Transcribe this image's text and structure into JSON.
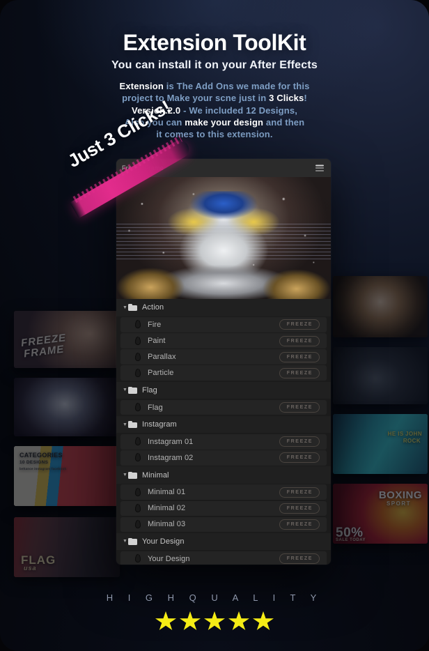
{
  "header": {
    "title": "Extension ToolKit",
    "subtitle": "You can install it on your After Effects"
  },
  "blurb": {
    "l1_bold": "Extension",
    "l1_rest": " is The Add Ons we made for this",
    "l2_a": "project to Make your scne just in ",
    "l2_bold": "3 Clicks",
    "l2_b": "!",
    "l3_bold": "Version.2.0",
    "l3_rest": " - We included 12 Designs,",
    "l4_a": "Also you can ",
    "l4_bold": "make your design",
    "l4_b": " and then",
    "l5": "it comes to this extension."
  },
  "badge": {
    "label": "Just 3 Clicks!"
  },
  "panel": {
    "header_title": "Freeze Frame",
    "menu_icon": "hamburger-menu-icon",
    "hero_image_alt": "ATV quad bike rider freeze frame preview",
    "freeze_label": "FREEZE",
    "rows": [
      {
        "type": "group",
        "label": "Action",
        "icon": "folder-icon",
        "caret": "▼"
      },
      {
        "type": "item",
        "label": "Fire",
        "icon": "flame-icon",
        "action": "FREEZE"
      },
      {
        "type": "item",
        "label": "Paint",
        "icon": "flame-icon",
        "action": "FREEZE"
      },
      {
        "type": "item",
        "label": "Parallax",
        "icon": "flame-icon",
        "action": "FREEZE"
      },
      {
        "type": "item",
        "label": "Particle",
        "icon": "flame-icon",
        "action": "FREEZE"
      },
      {
        "type": "group",
        "label": "Flag",
        "icon": "folder-icon",
        "caret": "▼"
      },
      {
        "type": "item",
        "label": "Flag",
        "icon": "flame-icon",
        "action": "FREEZE"
      },
      {
        "type": "group",
        "label": "Instagram",
        "icon": "folder-icon",
        "caret": "▼"
      },
      {
        "type": "item",
        "label": "Instagram 01",
        "icon": "flame-icon",
        "action": "FREEZE"
      },
      {
        "type": "item",
        "label": "Instagram 02",
        "icon": "flame-icon",
        "action": "FREEZE"
      },
      {
        "type": "group",
        "label": "Minimal",
        "icon": "folder-icon",
        "caret": "▼"
      },
      {
        "type": "item",
        "label": "Minimal 01",
        "icon": "flame-icon",
        "action": "FREEZE"
      },
      {
        "type": "item",
        "label": "Minimal 02",
        "icon": "flame-icon",
        "action": "FREEZE"
      },
      {
        "type": "item",
        "label": "Minimal 03",
        "icon": "flame-icon",
        "action": "FREEZE"
      },
      {
        "type": "group",
        "label": "Your Design",
        "icon": "folder-icon",
        "caret": "▼"
      },
      {
        "type": "item",
        "label": "Your Design",
        "icon": "flame-icon",
        "action": "FREEZE"
      }
    ]
  },
  "thumbnails": {
    "left": [
      {
        "name": "freeze-frame-thumb",
        "cap": "FREEZE",
        "cap2": "FRAME"
      },
      {
        "name": "quad-bike-thumb",
        "cap": "",
        "cap2": ""
      },
      {
        "name": "categories-thumb",
        "cap": "CATEGORIES",
        "cap2": "10 DESIGNS",
        "cap3": "behance  instagram  facebook"
      },
      {
        "name": "flag-thumb",
        "cap": "FLAG",
        "cap2": "usa"
      }
    ],
    "right": [
      {
        "name": "portrait-thumb",
        "cap": "",
        "cap2": ""
      },
      {
        "name": "soldier-thumb",
        "cap": "",
        "cap2": ""
      },
      {
        "name": "john-rock-thumb",
        "cap": "HE IS JOHN",
        "cap2": "ROCK"
      },
      {
        "name": "boxing-thumb",
        "cap": "BOXING",
        "cap2": "SPORT",
        "cap3": "50%",
        "cap4": "SALE TODAY"
      }
    ]
  },
  "footer": {
    "quality_label": "H I G H   Q U A L I T Y",
    "rating": 5,
    "star_color": "#f5ec16"
  },
  "colors": {
    "accent_pink": "#e22c8c",
    "panel_bg": "#1d1d1d",
    "row_bg": "#242424",
    "group_bg": "#202020",
    "text_blue": "#8fa7c6",
    "star_yellow": "#f5ec16"
  }
}
